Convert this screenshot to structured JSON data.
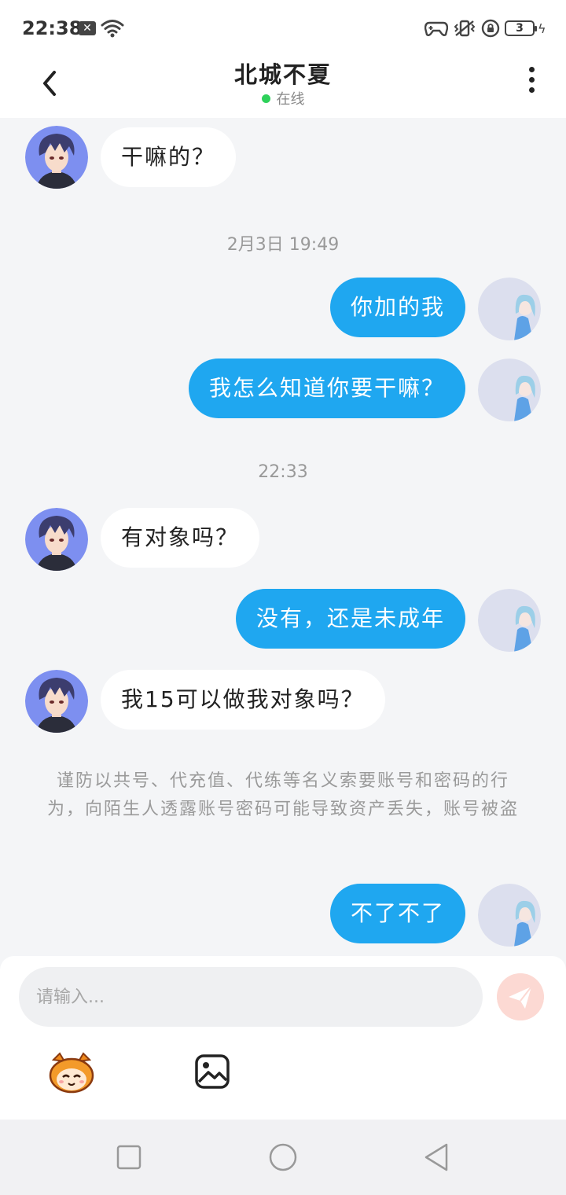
{
  "status_bar": {
    "time": "22:38",
    "notification_badge": "✕",
    "battery_level": "3",
    "icons": [
      "x-notification-icon",
      "wifi-icon",
      "gamepad-icon",
      "vibrate-icon",
      "rotation-lock-icon",
      "battery-icon",
      "charging-icon"
    ]
  },
  "header": {
    "title": "北城不夏",
    "status_text": "在线",
    "status_color": "#2ed15a"
  },
  "chat": {
    "messages": [
      {
        "side": "left",
        "text": "干嘛的？"
      },
      {
        "type": "timestamp",
        "text": "2月3日 19:49"
      },
      {
        "side": "right",
        "text": "你加的我"
      },
      {
        "side": "right",
        "text": "我怎么知道你要干嘛？"
      },
      {
        "type": "timestamp",
        "text": "22:33"
      },
      {
        "side": "left",
        "text": "有对象吗？"
      },
      {
        "side": "right",
        "text": "没有，还是未成年"
      },
      {
        "side": "left",
        "text": "我15可以做我对象吗？"
      },
      {
        "type": "notice",
        "text": "谨防以共号、代充值、代练等名义索要账号和密码的行为，向陌生人透露账号密码可能导致资产丢失，账号被盗"
      },
      {
        "side": "right",
        "text": "不了不了"
      }
    ]
  },
  "composer": {
    "placeholder": "请输入...",
    "send_button_color": "#fcd9d3"
  },
  "colors": {
    "accent": "#1fa7f0",
    "background": "#f4f5f7"
  }
}
